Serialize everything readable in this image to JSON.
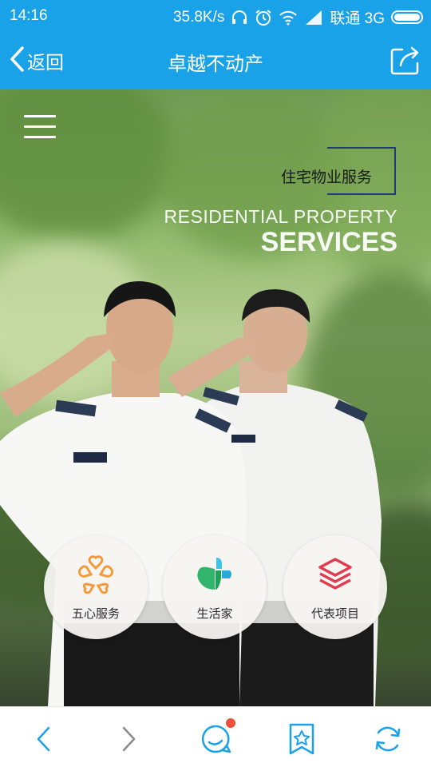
{
  "status_bar": {
    "time": "14:16",
    "network_speed": "35.8K/s",
    "carrier": "联通 3G",
    "icons": [
      "headphones-icon",
      "alarm-icon",
      "wifi-icon",
      "signal-icon",
      "battery-icon"
    ]
  },
  "header": {
    "back_label": "返回",
    "title": "卓越不动产",
    "share_icon": "share-icon"
  },
  "hero": {
    "menu_icon": "hamburger-menu-icon",
    "service_title": "住宅物业服务",
    "service_en_line1": "RESIDENTIAL PROPERTY",
    "service_en_line2": "SERVICES",
    "buttons": [
      {
        "label": "五心服务",
        "icon": "five-hearts-icon",
        "color": "#f39a3c"
      },
      {
        "label": "生活家",
        "icon": "life-home-icon",
        "color": "#2bb673"
      },
      {
        "label": "代表项目",
        "icon": "layers-icon",
        "color": "#e23a4e"
      }
    ]
  },
  "bottom_nav": {
    "items": [
      "back-arrow-icon",
      "forward-arrow-icon",
      "chat-bubble-icon",
      "bookmark-star-icon",
      "refresh-icon"
    ],
    "notification_color": "#f04e37",
    "accent_color": "#1aa2e8"
  }
}
